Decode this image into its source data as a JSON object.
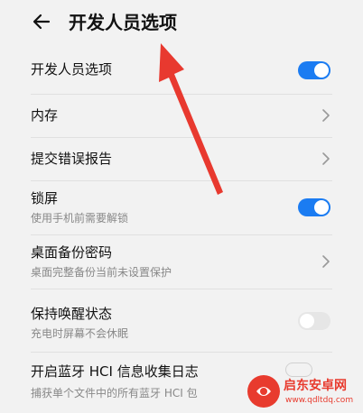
{
  "header": {
    "title": "开发人员选项"
  },
  "rows": [
    {
      "title": "开发人员选项",
      "control": "toggle",
      "state": "on"
    },
    {
      "title": "内存",
      "control": "chevron"
    },
    {
      "title": "提交错误报告",
      "control": "chevron"
    },
    {
      "title": "锁屏",
      "subtitle": "使用手机前需要解锁",
      "control": "toggle",
      "state": "on"
    },
    {
      "title": "桌面备份密码",
      "subtitle": "桌面完整备份当前未设置保护",
      "control": "chevron"
    },
    {
      "title": "保持唤醒状态",
      "subtitle": "充电时屏幕不会休眠",
      "control": "toggle",
      "state": "off"
    },
    {
      "title": "开启蓝牙 HCI 信息收集日志",
      "subtitle": "捕获单个文件中的所有蓝牙 HCI 包"
    }
  ],
  "watermark": {
    "brand": "启东安卓网",
    "url": "www.qdltdq.com"
  },
  "colors": {
    "accent": "#1b7cf2",
    "annotation_arrow": "#e8392f",
    "watermark": "#e83b2e"
  },
  "icons": {
    "back": "back-arrow-icon",
    "chevron": "chevron-right-icon"
  }
}
